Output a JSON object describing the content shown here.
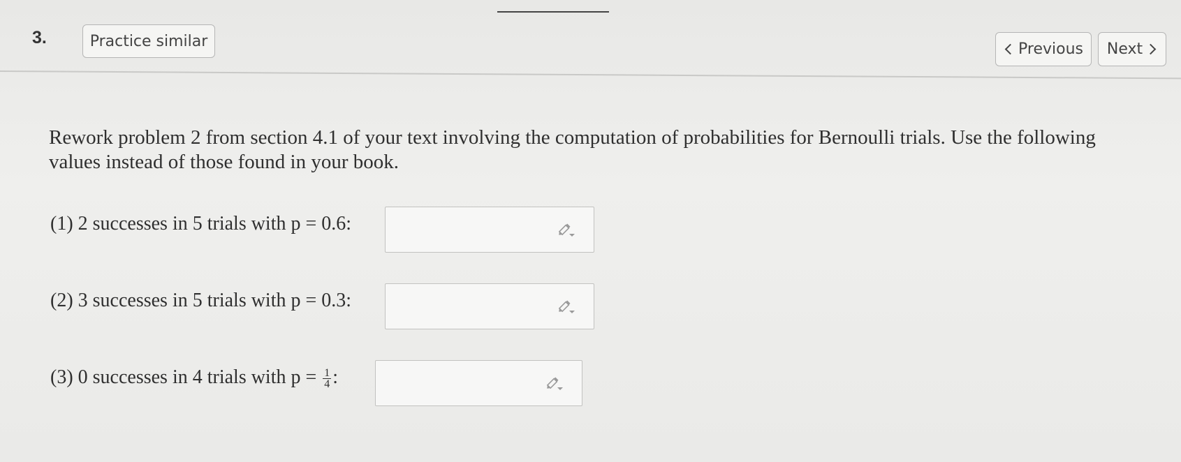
{
  "header": {
    "question_number": "3.",
    "practice_label": "Practice similar",
    "previous_label": "Previous",
    "next_label": "Next"
  },
  "problem": {
    "prompt": "Rework problem 2 from section 4.1 of your text involving the computation of probabilities for Bernoulli trials. Use the following values instead of those found in your book.",
    "parts": [
      {
        "label": "(1) 2 successes in 5 trials with p = 0.6:",
        "answer": ""
      },
      {
        "label": "(2) 3 successes in 5 trials with p = 0.3:",
        "answer": ""
      },
      {
        "label_prefix": "(3) 0 successes in 4 trials with p = ",
        "frac_num": "1",
        "frac_den": "4",
        "label_suffix": ":",
        "answer": ""
      }
    ]
  },
  "icons": {
    "answer_tool": "pencil-dropdown-icon",
    "previous": "chevron-left-icon",
    "next": "chevron-right-icon"
  },
  "colors": {
    "background": "#ebebea",
    "button_border": "#b5b5b5",
    "text": "#2f2f2f",
    "icon": "#9a9a9a"
  }
}
